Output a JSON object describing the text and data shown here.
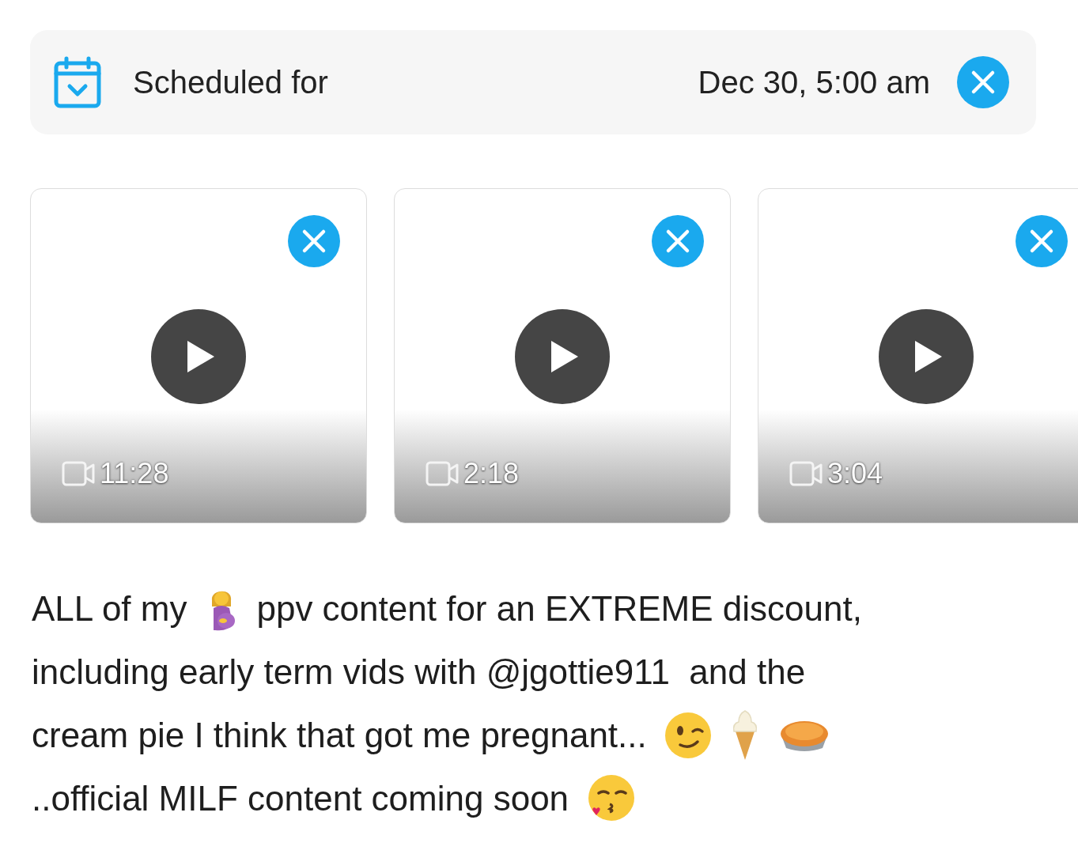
{
  "schedule": {
    "label": "Scheduled for",
    "date": "Dec 30, 5:00 am"
  },
  "media": [
    {
      "kind": "video",
      "duration": "11:28"
    },
    {
      "kind": "video",
      "duration": "2:18"
    },
    {
      "kind": "video",
      "duration": "3:04"
    }
  ],
  "caption": {
    "lines": [
      [
        {
          "kind": "text",
          "text": "ALL of my"
        },
        {
          "kind": "pregnant"
        },
        {
          "kind": "text",
          "text": "ppv content for an EXTREME discount,"
        }
      ],
      [
        {
          "kind": "text",
          "text": "including early term vids with @jgottie911  and the"
        }
      ],
      [
        {
          "kind": "text",
          "text": "cream pie I think that got me pregnant..."
        },
        {
          "kind": "wink"
        },
        {
          "kind": "icecream"
        },
        {
          "kind": "pie"
        }
      ],
      [
        {
          "kind": "text",
          "text": "..official MILF content coming soon"
        },
        {
          "kind": "kiss"
        }
      ]
    ]
  }
}
